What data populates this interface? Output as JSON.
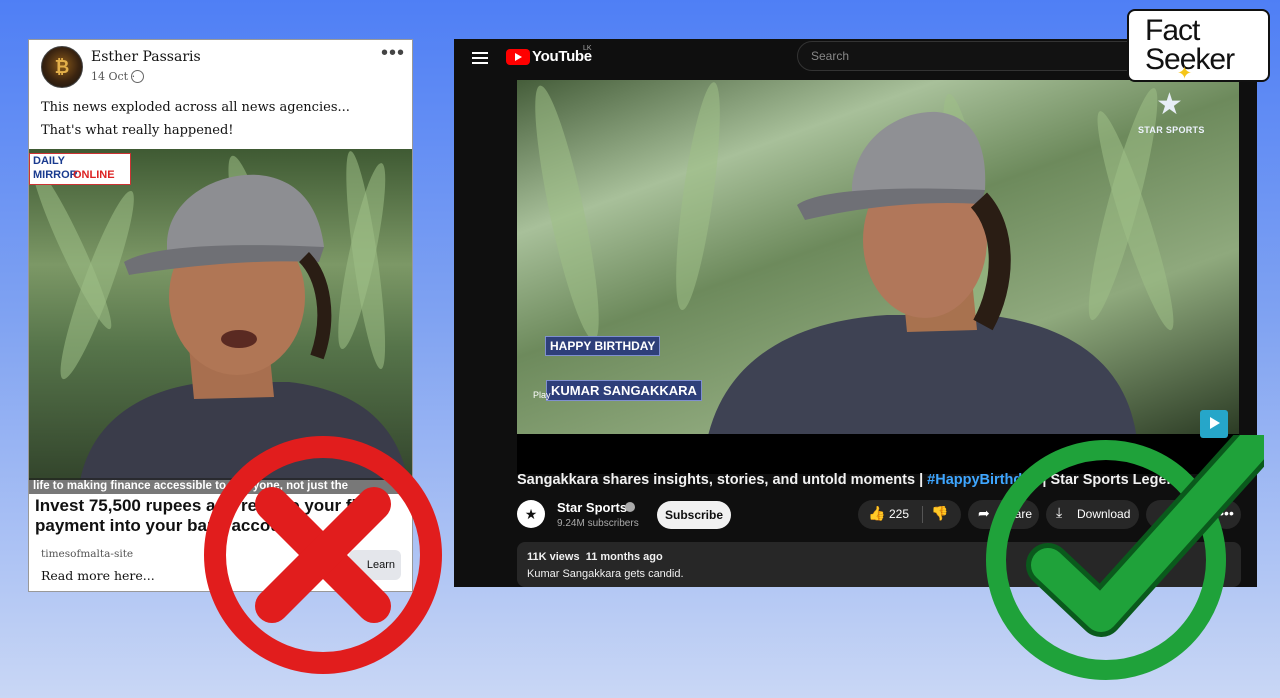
{
  "fb_post": {
    "author": "Esther Passaris",
    "avatar_glyph": "₿",
    "date": "14 Oct ·",
    "more_icon": "more-horizontal-icon",
    "text_line1": "This news exploded across all news agencies...",
    "text_line2": "That's what really happened!",
    "logo_daily": "DAILY",
    "logo_mirror": "MIRROR",
    "logo_online": "ONLINE",
    "caption": "life to making finance accessible to everyone, not just the",
    "headline": "Invest 75,500 rupees and receive your first payment into your bank account",
    "site": "timesofmalta-site",
    "read_more": "Read more here...",
    "learn_more": "Learn more"
  },
  "youtube": {
    "logo_text": "YouTube",
    "country": "LK",
    "search_placeholder": "Search",
    "overlay_birthday": "HAPPY BIRTHDAY",
    "overlay_name": "KUMAR SANGAKKARA",
    "play_label": "Play",
    "star_sports_logo": "STAR SPORTS",
    "title_part1": "Sangakkara shares insights, stories, and untold moments | ",
    "title_tag": "#HappyBirthday",
    "title_part2": " | Star Sports Legends",
    "channel_name": "Star Sports",
    "channel_avatar": "★",
    "subscribers": "9.24M subscribers",
    "subscribe_label": "Subscribe",
    "like_count": "225",
    "share_label": "Share",
    "download_label": "Download",
    "clip_label": "Clip",
    "views": "11K views",
    "age": "11 months ago",
    "description": "Kumar Sangakkara gets candid."
  },
  "branding": {
    "line1": "Fact",
    "line2": "Seeker"
  },
  "colors": {
    "wrong": "#e11d1d",
    "right": "#1fa23a",
    "youtube_red": "#ff0000",
    "hashtag": "#3ea6ff"
  },
  "verdicts": {
    "left": "false-cross-icon",
    "right": "true-checkmark-icon"
  }
}
